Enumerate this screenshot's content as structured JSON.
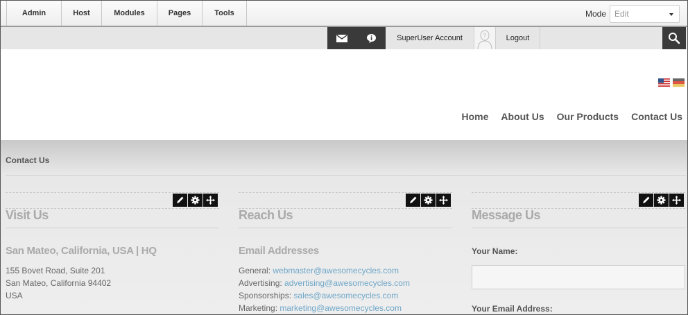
{
  "control_bar": {
    "menu": [
      "Admin",
      "Host",
      "Modules",
      "Pages",
      "Tools"
    ],
    "mode_label": "Mode",
    "mode_value": "Edit"
  },
  "user_bar": {
    "account": "SuperUser Account",
    "logout": "Logout",
    "icons": [
      "envelope-icon",
      "info-icon",
      "avatar-placeholder",
      "search-icon"
    ]
  },
  "languages": [
    "en-US",
    "de-DE"
  ],
  "main_nav": [
    "Home",
    "About Us",
    "Our Products",
    "Contact Us"
  ],
  "breadcrumb": "Contact Us",
  "panes": {
    "visit": {
      "title": "Visit Us",
      "subtitle": "San Mateo, California, USA | HQ",
      "address": [
        "155 Bovet Road, Suite 201",
        "San Mateo, California 94402",
        "USA"
      ]
    },
    "reach": {
      "title": "Reach Us",
      "subtitle": "Email Addresses",
      "emails": [
        {
          "label": "General:",
          "email": "webmaster@awesomecycles.com"
        },
        {
          "label": "Advertising:",
          "email": "advertising@awesomecycles.com"
        },
        {
          "label": "Sponsorships:",
          "email": "sales@awesomecycles.com"
        },
        {
          "label": "Marketing:",
          "email": "marketing@awesomecycles.com"
        }
      ]
    },
    "message": {
      "title": "Message Us",
      "name_label": "Your Name:",
      "email_label": "Your Email Address:"
    }
  },
  "colors": {
    "dark_button": "#3a3a3a",
    "link": "#6fa7c8",
    "heading": "#aaaaaa"
  }
}
